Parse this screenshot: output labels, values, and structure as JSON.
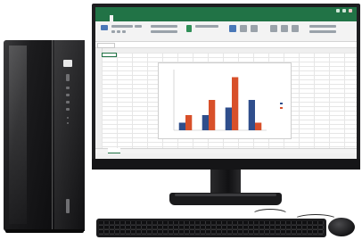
{
  "scene": {
    "description_free": true,
    "objects": [
      "desktop-tower",
      "monitor",
      "keyboard",
      "mouse"
    ]
  },
  "tower": {
    "badge_text": "",
    "colors": {
      "body": "#111113",
      "accent": "#6f6f72"
    }
  },
  "monitor": {
    "app": "spreadsheet",
    "title_bar_text": "",
    "ribbon_tabs": [
      "",
      "",
      "",
      "",
      "",
      "",
      "",
      ""
    ],
    "active_tab_index": 1,
    "brand_color": "#217346",
    "chin_logo": ""
  },
  "chart_data": {
    "type": "bar",
    "categories": [
      "",
      "",
      "",
      ""
    ],
    "series": [
      {
        "color": "#2f4e8c",
        "values": [
          1,
          2,
          3,
          4
        ]
      },
      {
        "color": "#d8502a",
        "values": [
          2,
          4,
          7,
          1
        ]
      }
    ],
    "title": "",
    "xlabel": "",
    "ylabel": "",
    "ylim": [
      0,
      8
    ],
    "grid": false,
    "legend": "right"
  },
  "icons": {
    "window": [
      "minimize-icon",
      "maximize-icon",
      "close-icon"
    ]
  }
}
